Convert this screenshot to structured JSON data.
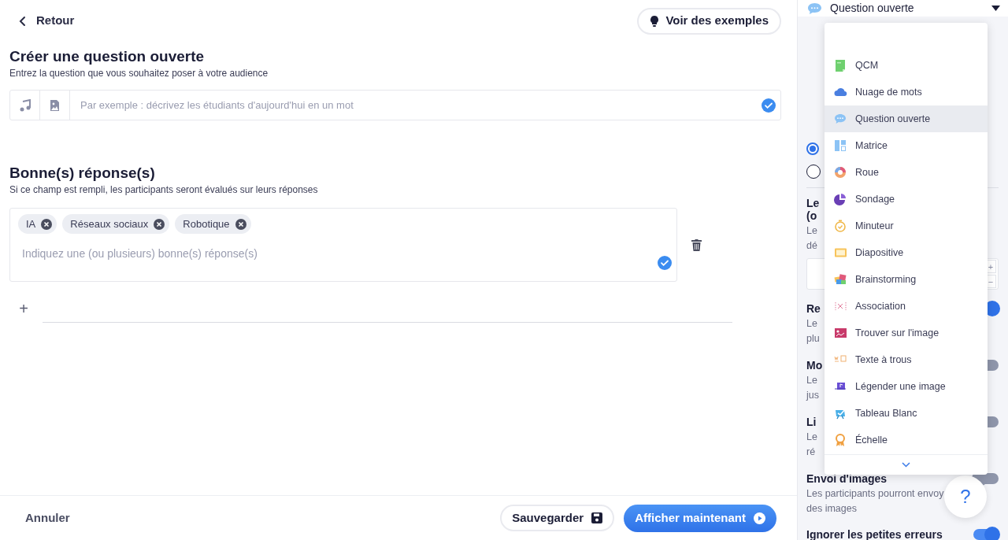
{
  "top_bar": {
    "back_label": "Retour",
    "examples_button": "Voir des exemples"
  },
  "question": {
    "title": "Créer une question ouverte",
    "subtitle": "Entrez la question que vous souhaitez poser à votre audience",
    "placeholder": "Par exemple : décrivez les étudiants d'aujourd'hui en un mot"
  },
  "answers": {
    "title": "Bonne(s) réponse(s)",
    "subtitle": "Si ce champ est rempli, les participants seront évalués sur leurs réponses",
    "tags": [
      "IA",
      "Réseaux sociaux",
      "Robotique"
    ],
    "placeholder": "Indiquez une (ou plusieurs) bonne(s) réponse(s)",
    "add_label": "+"
  },
  "footer": {
    "cancel": "Annuler",
    "save": "Sauvegarder",
    "present": "Afficher maintenant"
  },
  "settings_panel": {
    "type_select": "Question ouverte",
    "radios": [
      {
        "selected": true
      },
      {
        "selected": false
      }
    ],
    "settings": [
      {
        "kind": "number",
        "title_lines": [
          "Le",
          "(o"
        ],
        "description_lines": [
          "Le",
          "dé"
        ],
        "stepper": [
          "+",
          "−"
        ]
      },
      {
        "kind": "toggle",
        "title_lines": [
          "Re"
        ],
        "description_lines": [
          "Le",
          "plu"
        ],
        "on": true
      },
      {
        "kind": "toggle",
        "title_lines": [
          "Mo"
        ],
        "description_lines": [
          "Le",
          "jus"
        ],
        "on": false
      },
      {
        "kind": "toggle",
        "title_lines": [
          "Li"
        ],
        "description_lines": [
          "Le",
          "ré"
        ],
        "on": false
      },
      {
        "kind": "toggle",
        "title_lines": [
          "Envoi d'images"
        ],
        "description_lines": [
          "Les participants pourront envoy",
          "des images"
        ],
        "on": false
      },
      {
        "kind": "toggle",
        "title_lines": [
          "Ignorer les petites erreurs"
        ],
        "on": true
      }
    ],
    "help_button": "?"
  },
  "type_menu": {
    "items": [
      {
        "label": "QCM",
        "selected": false
      },
      {
        "label": "Nuage de mots",
        "selected": false
      },
      {
        "label": "Question ouverte",
        "selected": true
      },
      {
        "label": "Matrice",
        "selected": false
      },
      {
        "label": "Roue",
        "selected": false
      },
      {
        "label": "Sondage",
        "selected": false
      },
      {
        "label": "Minuteur",
        "selected": false
      },
      {
        "label": "Diapositive",
        "selected": false
      },
      {
        "label": "Brainstorming",
        "selected": false
      },
      {
        "label": "Association",
        "selected": false
      },
      {
        "label": "Trouver sur l'image",
        "selected": false
      },
      {
        "label": "Texte à trous",
        "selected": false
      },
      {
        "label": "Légender une image",
        "selected": false
      },
      {
        "label": "Tableau Blanc",
        "selected": false
      },
      {
        "label": "Échelle",
        "selected": false
      }
    ]
  }
}
